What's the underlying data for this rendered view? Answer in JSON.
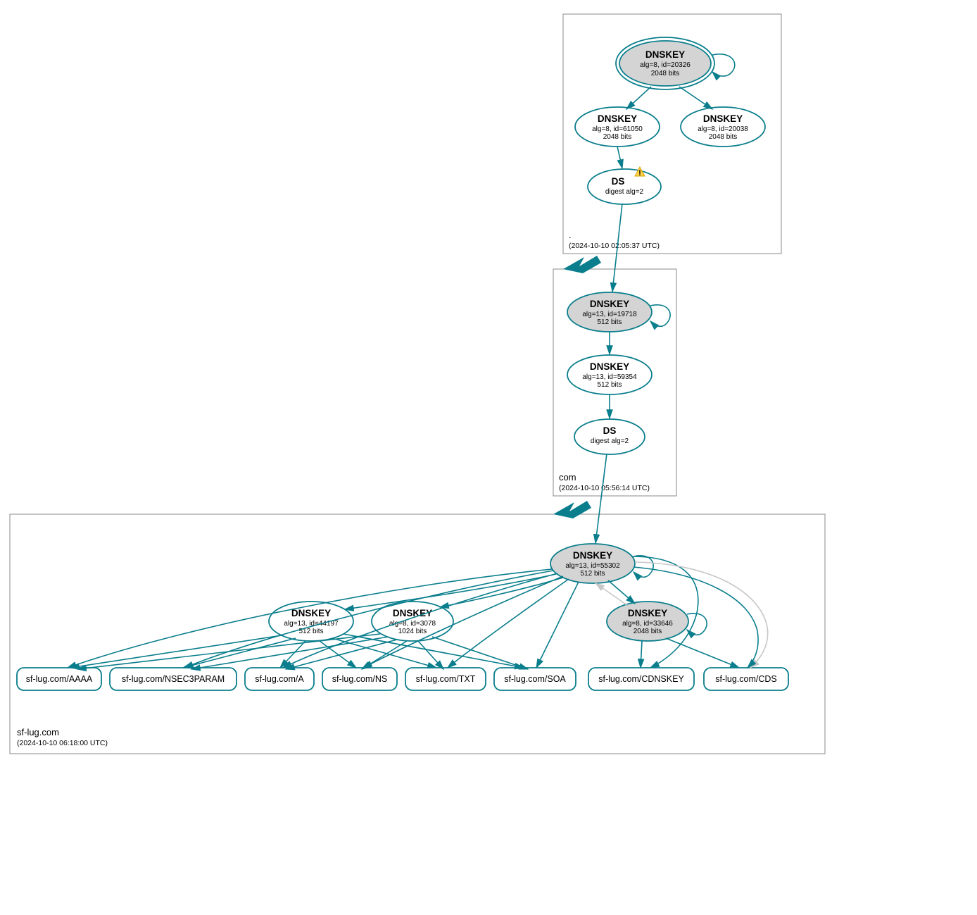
{
  "zones": {
    "root": {
      "label": ".",
      "timestamp": "(2024-10-10 02:05:37 UTC)"
    },
    "com": {
      "label": "com",
      "timestamp": "(2024-10-10 05:56:14 UTC)"
    },
    "domain": {
      "label": "sf-lug.com",
      "timestamp": "(2024-10-10 06:18:00 UTC)"
    }
  },
  "nodes": {
    "root_ksk": {
      "title": "DNSKEY",
      "alg": "alg=8, id=20326",
      "bits": "2048 bits"
    },
    "root_zsk1": {
      "title": "DNSKEY",
      "alg": "alg=8, id=61050",
      "bits": "2048 bits"
    },
    "root_zsk2": {
      "title": "DNSKEY",
      "alg": "alg=8, id=20038",
      "bits": "2048 bits"
    },
    "root_ds": {
      "title": "DS",
      "alg": "digest alg=2"
    },
    "com_ksk": {
      "title": "DNSKEY",
      "alg": "alg=13, id=19718",
      "bits": "512 bits"
    },
    "com_zsk": {
      "title": "DNSKEY",
      "alg": "alg=13, id=59354",
      "bits": "512 bits"
    },
    "com_ds": {
      "title": "DS",
      "alg": "digest alg=2"
    },
    "dom_ksk": {
      "title": "DNSKEY",
      "alg": "alg=13, id=55302",
      "bits": "512 bits"
    },
    "dom_zsk1": {
      "title": "DNSKEY",
      "alg": "alg=13, id=44197",
      "bits": "512 bits"
    },
    "dom_zsk2": {
      "title": "DNSKEY",
      "alg": "alg=8, id=3078",
      "bits": "1024 bits"
    },
    "dom_zsk3": {
      "title": "DNSKEY",
      "alg": "alg=8, id=33646",
      "bits": "2048 bits"
    }
  },
  "rr": {
    "aaaa": "sf-lug.com/AAAA",
    "nsec3p": "sf-lug.com/NSEC3PARAM",
    "a": "sf-lug.com/A",
    "ns": "sf-lug.com/NS",
    "txt": "sf-lug.com/TXT",
    "soa": "sf-lug.com/SOA",
    "cdnskey": "sf-lug.com/CDNSKEY",
    "cds": "sf-lug.com/CDS"
  }
}
